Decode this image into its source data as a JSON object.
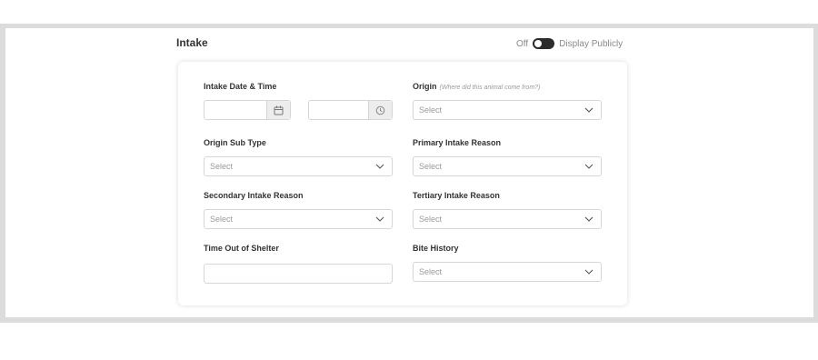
{
  "section": {
    "title": "Intake",
    "toggle_off_label": "Off",
    "toggle_label": "Display Publicly"
  },
  "form": {
    "intake_datetime": {
      "label": "Intake Date & Time",
      "date_value": "",
      "time_value": ""
    },
    "origin": {
      "label": "Origin",
      "hint": "(Where did this animal come from?)",
      "value": "Select"
    },
    "origin_sub_type": {
      "label": "Origin Sub Type",
      "value": "Select"
    },
    "primary_intake_reason": {
      "label": "Primary Intake Reason",
      "value": "Select"
    },
    "secondary_intake_reason": {
      "label": "Secondary Intake Reason",
      "value": "Select"
    },
    "tertiary_intake_reason": {
      "label": "Tertiary Intake Reason",
      "value": "Select"
    },
    "time_out_of_shelter": {
      "label": "Time Out of Shelter",
      "value": ""
    },
    "bite_history": {
      "label": "Bite History",
      "value": "Select"
    }
  },
  "icons": {
    "date": "calendar-icon",
    "time": "clock-icon",
    "dropdown": "chevron-down-icon"
  },
  "colors": {
    "toggle_track": "#2b2b2b",
    "border": "#d6d6d6",
    "frame": "#dcdcdc"
  }
}
